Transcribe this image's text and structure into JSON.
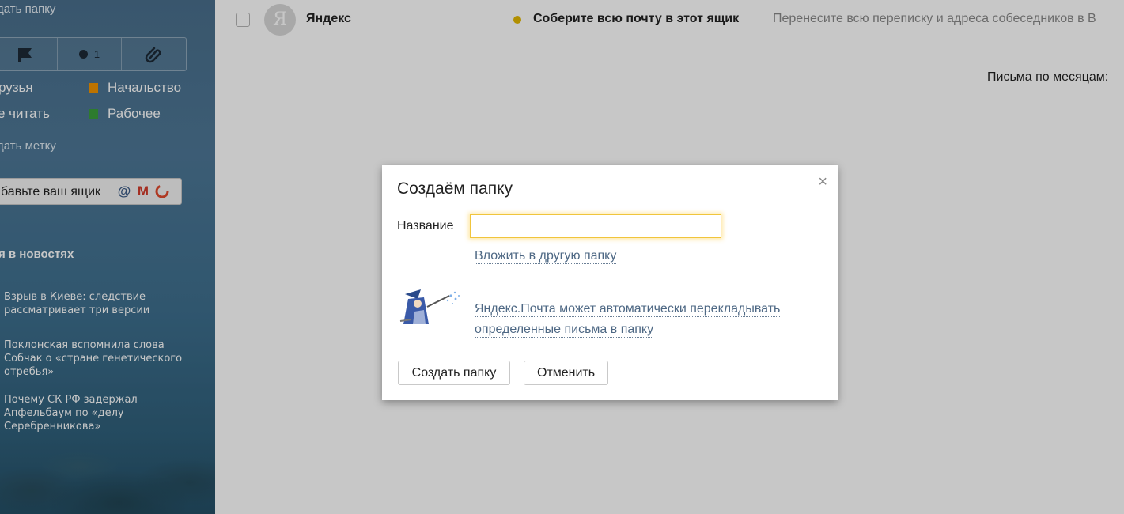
{
  "sidebar": {
    "new_folder": "дать папку",
    "toolbar": {
      "dot_count": "1"
    },
    "labels": [
      {
        "text": "рузья",
        "color": ""
      },
      {
        "text": "Начальство",
        "color": "#f29400"
      },
      {
        "text": "е читать",
        "color": ""
      },
      {
        "text": "Рабочее",
        "color": "#3a9e3a"
      }
    ],
    "create_label": "дать метку",
    "add_mailbox": "бавьте ваш ящик",
    "news_title": "я в новостях",
    "news": [
      "Взрыв в Киеве: следствие рассматривает три версии",
      "Поклонская вспомнила слова Собчак о «стране генетического отребья»",
      "Почему СК РФ задержал Апфельбаум по «делу Серебренникова»"
    ]
  },
  "mail": {
    "avatar_letter": "Я",
    "sender": "Яндекс",
    "subject": "Соберите всю почту в этот ящик",
    "snippet": "Перенесите всю переписку и адреса собеседников в В",
    "by_month": "Письма по месяцам:"
  },
  "dialog": {
    "title": "Создаём папку",
    "close": "×",
    "name_label": "Название",
    "name_value": "",
    "nest_link": "Вложить в другую папку",
    "auto_link_line1": "Яндекс.Почта может автоматически перекладывать",
    "auto_link_line2": "определенные письма в папку",
    "create_button": "Создать папку",
    "cancel_button": "Отменить"
  },
  "colors": {
    "accent_yellow": "#f0c53c",
    "link": "#4e6884",
    "label_orange": "#f29400",
    "label_green": "#3a9e3a"
  }
}
